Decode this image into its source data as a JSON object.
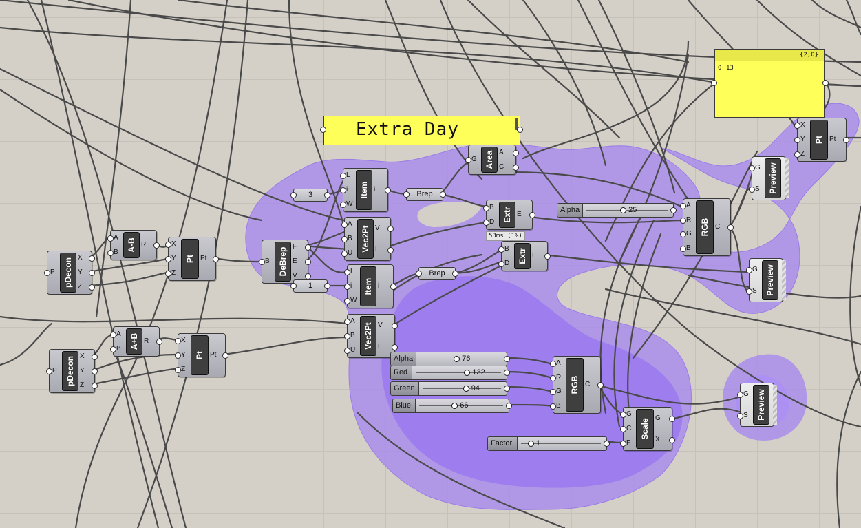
{
  "scribble": {
    "text": "Extra Day"
  },
  "yellow_panel": {
    "path": "{2;0}",
    "index": "0",
    "value": "13"
  },
  "timing": {
    "text": "53ms (1%)"
  },
  "components": {
    "pdecon1": {
      "name": "pDecon",
      "in": [
        "P"
      ],
      "out": [
        "X",
        "Y",
        "Z"
      ]
    },
    "pdecon2": {
      "name": "pDecon",
      "in": [
        "P"
      ],
      "out": [
        "X",
        "Y",
        "Z"
      ]
    },
    "minus": {
      "name": "A-B",
      "in": [
        "A",
        "B"
      ],
      "out": [
        "R"
      ]
    },
    "plus": {
      "name": "A+B",
      "in": [
        "A",
        "B"
      ],
      "out": [
        "R"
      ]
    },
    "pt1": {
      "name": "Pt",
      "in": [
        "X",
        "Y",
        "Z"
      ],
      "out": [
        "Pt"
      ]
    },
    "pt2": {
      "name": "Pt",
      "in": [
        "X",
        "Y",
        "Z"
      ],
      "out": [
        "Pt"
      ]
    },
    "pt3": {
      "name": "Pt",
      "in": [
        "X",
        "Y",
        "Z"
      ],
      "out": [
        "Pt"
      ]
    },
    "debrep": {
      "name": "DeBrep",
      "in": [
        "B"
      ],
      "out": [
        "F",
        "E",
        "V"
      ]
    },
    "item1": {
      "name": "Item",
      "in": [
        "L",
        "i",
        "W"
      ],
      "out": [
        "i"
      ]
    },
    "item2": {
      "name": "Item",
      "in": [
        "L",
        "i",
        "W"
      ],
      "out": [
        "i"
      ]
    },
    "vec2pt1": {
      "name": "Vec2Pt",
      "in": [
        "A",
        "B",
        "U"
      ],
      "out": [
        "V",
        "L"
      ]
    },
    "vec2pt2": {
      "name": "Vec2Pt",
      "in": [
        "A",
        "B",
        "U"
      ],
      "out": [
        "V",
        "L"
      ]
    },
    "area": {
      "name": "Area",
      "in": [
        "G"
      ],
      "out": [
        "A",
        "C"
      ]
    },
    "extr1": {
      "name": "Extr",
      "in": [
        "B",
        "D"
      ],
      "out": [
        "E"
      ]
    },
    "extr2": {
      "name": "Extr",
      "in": [
        "B",
        "D"
      ],
      "out": [
        "E"
      ]
    },
    "rgb1": {
      "name": "RGB",
      "in": [
        "A",
        "R",
        "G",
        "B"
      ],
      "out": [
        "C"
      ]
    },
    "rgb2": {
      "name": "RGB",
      "in": [
        "A",
        "R",
        "G",
        "B"
      ],
      "out": [
        "C"
      ]
    },
    "scale": {
      "name": "Scale",
      "in": [
        "G",
        "C",
        "F"
      ],
      "out": [
        "G",
        "X"
      ]
    },
    "preview1": {
      "name": "Preview",
      "in": [
        "G",
        "S"
      ]
    },
    "preview2": {
      "name": "Preview",
      "in": [
        "G",
        "S"
      ]
    },
    "preview3": {
      "name": "Preview",
      "in": [
        "G",
        "S"
      ]
    }
  },
  "params": {
    "num3": "3",
    "num1": "1",
    "brep1": "Brep",
    "brep2": "Brep"
  },
  "sliders": {
    "alpha_top": {
      "name": "Alpha",
      "value": "25"
    },
    "alpha": {
      "name": "Alpha",
      "value": "76"
    },
    "red": {
      "name": "Red",
      "value": "132"
    },
    "green": {
      "name": "Green",
      "value": "94"
    },
    "blue": {
      "name": "Blue",
      "value": "66"
    },
    "factor": {
      "name": "Factor",
      "value": "1"
    }
  },
  "colors": {
    "canvas": "#d4d0c8",
    "group": "#a082f0",
    "panel": "#ffff5a",
    "wire": "#4a4a4a"
  }
}
